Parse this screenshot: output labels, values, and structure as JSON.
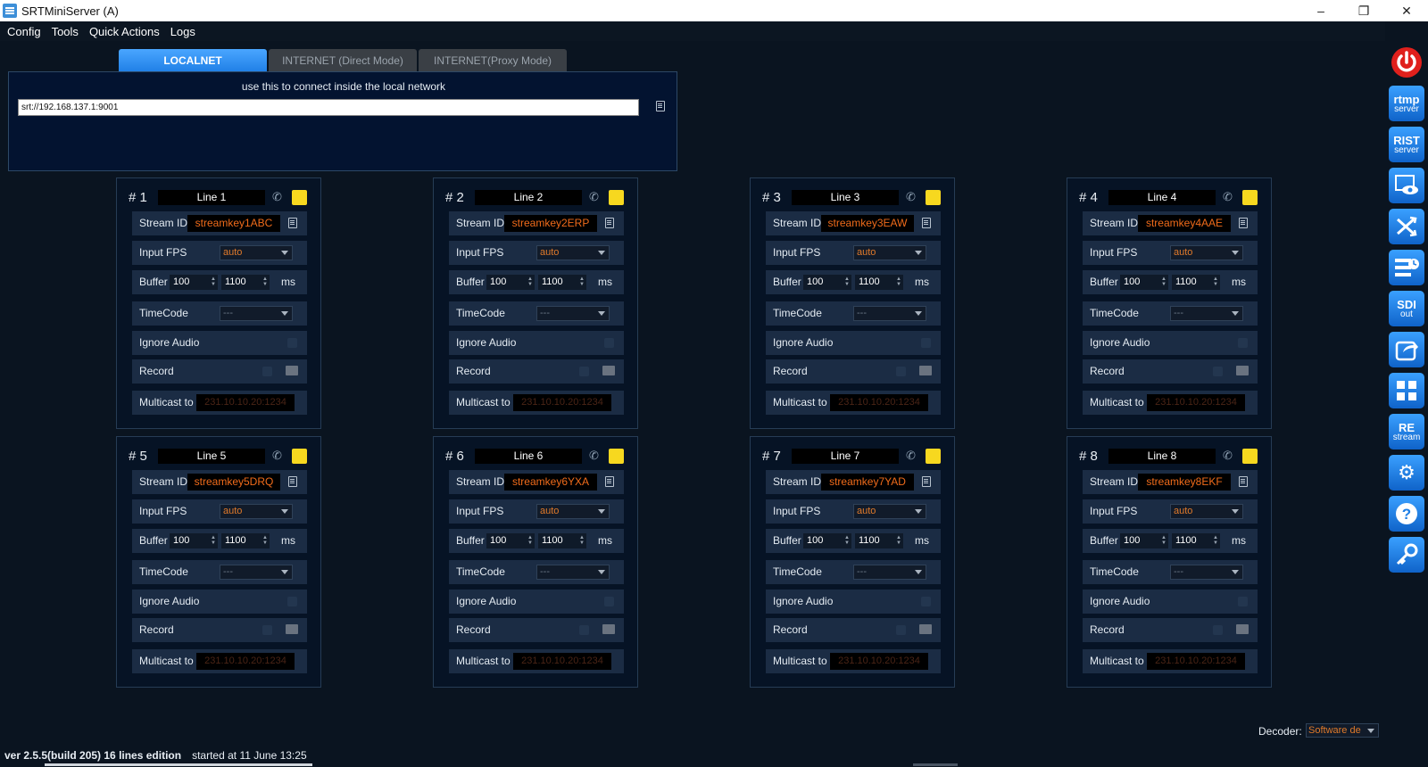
{
  "window": {
    "title": "SRTMiniServer (A)",
    "minimize": "–",
    "maximize": "❐",
    "close": "✕"
  },
  "menu": [
    "Config",
    "Tools",
    "Quick Actions",
    "Logs"
  ],
  "tabs": [
    {
      "label": "LOCALNET",
      "active": true
    },
    {
      "label": "INTERNET (Direct Mode)",
      "active": false
    },
    {
      "label": "INTERNET(Proxy Mode)",
      "active": false
    }
  ],
  "connection": {
    "hint": "use this to connect inside the local network",
    "url": "srt://192.168.137.1:9001"
  },
  "labels": {
    "stream_id": "Stream ID",
    "input_fps": "Input FPS",
    "buffer": "Buffer",
    "ms": "ms",
    "timecode": "TimeCode",
    "ignore_audio": "Ignore Audio",
    "record": "Record",
    "multicast": "Multicast to"
  },
  "lines": [
    {
      "num": "# 1",
      "name": "Line 1",
      "stream_id": "streamkey1ABC",
      "fps": "auto",
      "buf_min": "100",
      "buf_max": "1100",
      "timecode": "---",
      "multicast": "231.10.10.20:1234"
    },
    {
      "num": "# 2",
      "name": "Line 2",
      "stream_id": "streamkey2ERP",
      "fps": "auto",
      "buf_min": "100",
      "buf_max": "1100",
      "timecode": "---",
      "multicast": "231.10.10.20:1234"
    },
    {
      "num": "# 3",
      "name": "Line 3",
      "stream_id": "streamkey3EAW",
      "fps": "auto",
      "buf_min": "100",
      "buf_max": "1100",
      "timecode": "---",
      "multicast": "231.10.10.20:1234"
    },
    {
      "num": "# 4",
      "name": "Line 4",
      "stream_id": "streamkey4AAE",
      "fps": "auto",
      "buf_min": "100",
      "buf_max": "1100",
      "timecode": "---",
      "multicast": "231.10.10.20:1234"
    },
    {
      "num": "# 5",
      "name": "Line 5",
      "stream_id": "streamkey5DRQ",
      "fps": "auto",
      "buf_min": "100",
      "buf_max": "1100",
      "timecode": "---",
      "multicast": "231.10.10.20:1234"
    },
    {
      "num": "# 6",
      "name": "Line 6",
      "stream_id": "streamkey6YXA",
      "fps": "auto",
      "buf_min": "100",
      "buf_max": "1100",
      "timecode": "---",
      "multicast": "231.10.10.20:1234"
    },
    {
      "num": "# 7",
      "name": "Line 7",
      "stream_id": "streamkey7YAD",
      "fps": "auto",
      "buf_min": "100",
      "buf_max": "1100",
      "timecode": "---",
      "multicast": "231.10.10.20:1234"
    },
    {
      "num": "# 8",
      "name": "Line 8",
      "stream_id": "streamkey8EKF",
      "fps": "auto",
      "buf_min": "100",
      "buf_max": "1100",
      "timecode": "---",
      "multicast": "231.10.10.20:1234"
    }
  ],
  "toolbar": {
    "rtmp": {
      "line1": "rtmp",
      "line2": "server"
    },
    "rist": {
      "line1": "RIST",
      "line2": "server"
    },
    "sdi": {
      "line1": "SDI",
      "line2": "out"
    },
    "restream": {
      "line1": "RE",
      "line2": "stream"
    },
    "icons": [
      "power-icon",
      "rtmp-server-icon",
      "rist-server-icon",
      "preview-icon",
      "shuffle-icon",
      "schedule-icon",
      "sdi-out-icon",
      "share-icon",
      "layout-icon",
      "restream-icon",
      "gear-icon",
      "help-icon",
      "key-icon"
    ]
  },
  "decoder": {
    "label": "Decoder:",
    "value": "Software de"
  },
  "status": {
    "version": "ver 2.5.5(build 205) 16 lines edition",
    "started": "started at 11 June 13:25"
  },
  "colors": {
    "accent": "#1f7fe6",
    "status_yellow": "#f7d81f",
    "stream_text": "#f06b1a",
    "panel_bg": "#061325"
  }
}
